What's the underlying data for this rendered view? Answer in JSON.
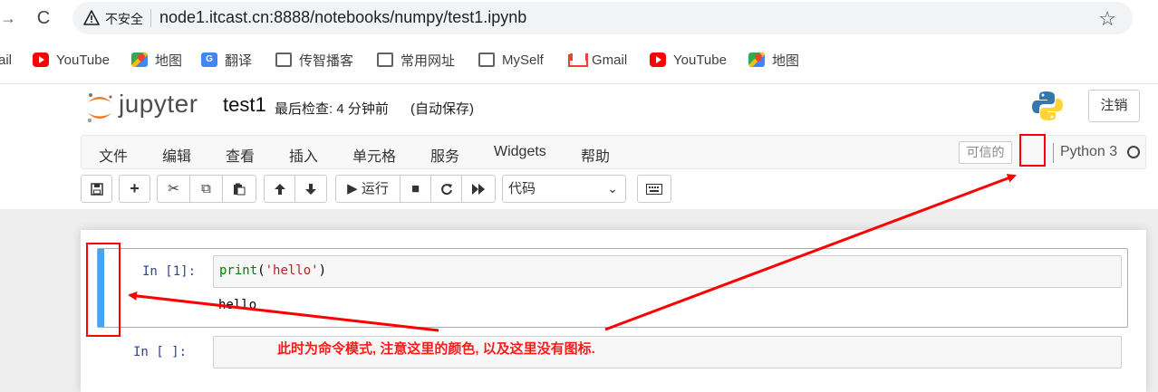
{
  "browser": {
    "nav_fwd_glyph": "→",
    "reload_glyph": "C",
    "security_label": "不安全",
    "url": "node1.itcast.cn:8888/notebooks/numpy/test1.ipynb",
    "star_glyph": "☆",
    "bookmarks": [
      {
        "label": "ail",
        "icon": "none"
      },
      {
        "label": "YouTube",
        "icon": "youtube-icon"
      },
      {
        "label": "地图",
        "icon": "maps-icon"
      },
      {
        "label": "翻译",
        "icon": "translate-icon"
      },
      {
        "label": "传智播客",
        "icon": "folder-icon"
      },
      {
        "label": "常用网址",
        "icon": "folder-icon"
      },
      {
        "label": "MySelf",
        "icon": "folder-icon"
      },
      {
        "label": "Gmail",
        "icon": "gmail-icon"
      },
      {
        "label": "YouTube",
        "icon": "youtube-icon"
      },
      {
        "label": "地图",
        "icon": "maps-icon"
      }
    ]
  },
  "jupyter": {
    "wordmark": "jupyter",
    "notebook_name": "test1",
    "checkpoint": "最后检查: 4 分钟前",
    "autosave": "(自动保存)",
    "logout_label": "注销",
    "menu": [
      "文件",
      "编辑",
      "查看",
      "插入",
      "单元格",
      "服务",
      "Widgets",
      "帮助"
    ],
    "trusted_label": "可信的",
    "kernel_name": "Python 3",
    "toolbar": {
      "save_glyph": "🖫",
      "add_glyph": "+",
      "cut_glyph": "✂",
      "copy_glyph": "⧉",
      "paste_glyph": "📋",
      "up_glyph": "🡅",
      "down_glyph": "🡇",
      "run_label": "▶ 运行",
      "stop_glyph": "■",
      "restart_glyph": "C",
      "fastforward_glyph": "⏩",
      "cell_type": "代码",
      "keyboard_glyph": "⌨"
    },
    "cells": [
      {
        "prompt": "In  [1]:",
        "code_builtin": "print",
        "code_open": "(",
        "code_str": "'hello'",
        "code_close": ")",
        "output": "hello"
      },
      {
        "prompt": "In  [ ]:"
      }
    ]
  },
  "annotation": {
    "note": "此时为命令模式, 注意这里的颜色, 以及这里没有图标.",
    "color": "#ff0000"
  },
  "colors": {
    "command_mode_bar": "#42a5f5",
    "prompt": "#303f9f"
  }
}
